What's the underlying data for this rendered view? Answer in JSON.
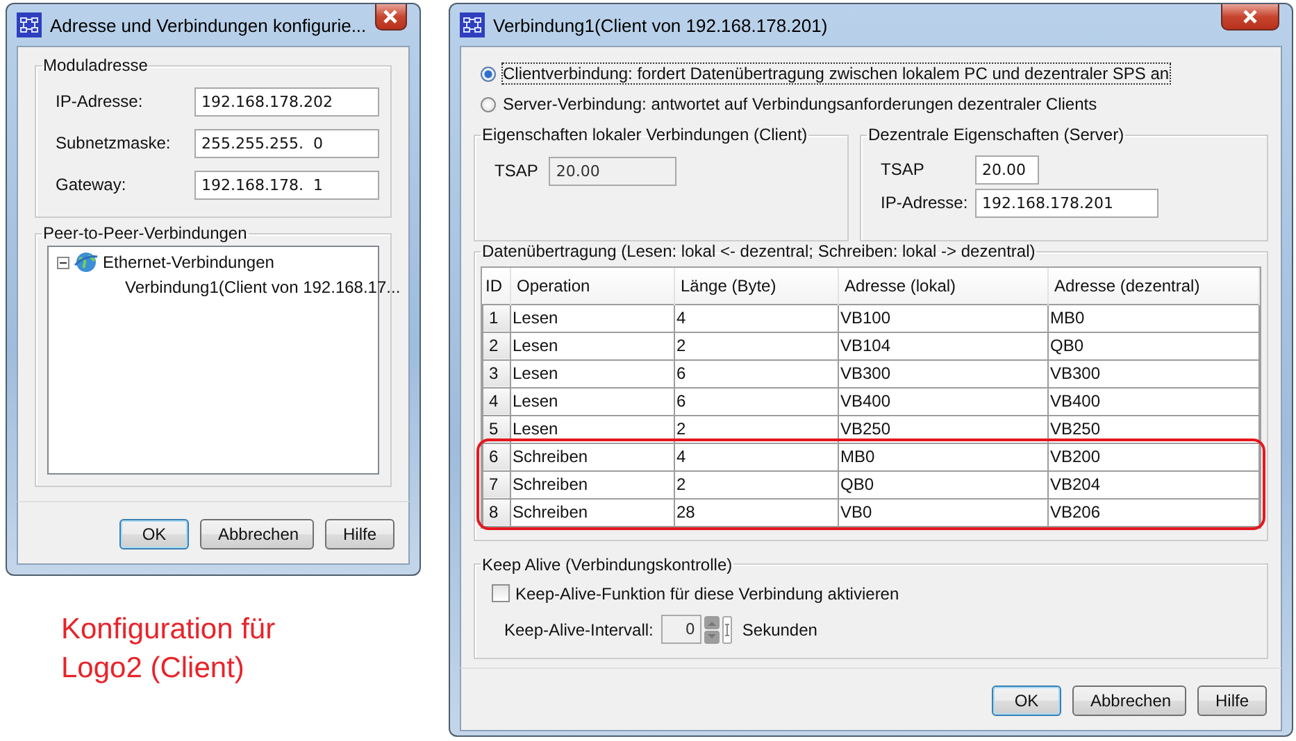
{
  "address_dialog": {
    "title": "Adresse und Verbindungen konfigurie...",
    "module_address": {
      "legend": "Moduladresse",
      "fields": [
        {
          "label": "IP-Adresse:",
          "value": "192.168.178.202"
        },
        {
          "label": "Subnetzmaske:",
          "value": "255.255.255.  0"
        },
        {
          "label": "Gateway:",
          "value": "192.168.178.  1"
        }
      ]
    },
    "peer_connections": {
      "legend": "Peer-to-Peer-Verbindungen",
      "tree": [
        {
          "label": "Ethernet-Verbindungen",
          "expanded": true,
          "children": [
            {
              "label": "Verbindung1(Client von  192.168.17..."
            }
          ]
        }
      ]
    },
    "buttons": [
      {
        "label": "OK",
        "default": true
      },
      {
        "label": "Abbrechen",
        "default": false
      },
      {
        "label": "Hilfe",
        "default": false
      }
    ]
  },
  "caption": "Konfiguration für Logo2 (Client)",
  "connection_dialog": {
    "title": "Verbindung1(Client von  192.168.178.201)",
    "connection_types": [
      {
        "label": "Clientverbindung: fordert Datenübertragung zwischen lokalem PC und dezentraler SPS an",
        "selected": true
      },
      {
        "label": "Server-Verbindung: antwortet auf Verbindungsanforderungen dezentraler Clients",
        "selected": false
      }
    ],
    "local_properties": {
      "legend": "Eigenschaften lokaler Verbindungen (Client)",
      "fields": [
        {
          "label": "TSAP",
          "value": "20.00",
          "disabled": true
        }
      ]
    },
    "remote_properties": {
      "legend": "Dezentrale Eigenschaften (Server)",
      "fields": [
        {
          "label": "TSAP",
          "value": "20.00",
          "disabled": false
        },
        {
          "label": "IP-Adresse:",
          "value": "192.168.178.201",
          "disabled": false
        }
      ]
    },
    "data_transfer": {
      "legend": "Datenübertragung (Lesen: lokal <- dezentral; Schreiben: lokal -> dezentral)",
      "columns": [
        "ID",
        "Operation",
        "Länge (Byte)",
        "Adresse (lokal)",
        "Adresse (dezentral)"
      ],
      "rows": [
        {
          "cells": [
            "1",
            "Lesen",
            "4",
            "VB100",
            "MB0"
          ],
          "highlighted": false
        },
        {
          "cells": [
            "2",
            "Lesen",
            "2",
            "VB104",
            "QB0"
          ],
          "highlighted": false
        },
        {
          "cells": [
            "3",
            "Lesen",
            "6",
            "VB300",
            "VB300"
          ],
          "highlighted": false
        },
        {
          "cells": [
            "4",
            "Lesen",
            "6",
            "VB400",
            "VB400"
          ],
          "highlighted": false
        },
        {
          "cells": [
            "5",
            "Lesen",
            "2",
            "VB250",
            "VB250"
          ],
          "highlighted": false
        },
        {
          "cells": [
            "6",
            "Schreiben",
            "4",
            "MB0",
            "VB200"
          ],
          "highlighted": true
        },
        {
          "cells": [
            "7",
            "Schreiben",
            "2",
            "QB0",
            "VB204"
          ],
          "highlighted": true
        },
        {
          "cells": [
            "8",
            "Schreiben",
            "28",
            "VB0",
            "VB206"
          ],
          "highlighted": true
        }
      ]
    },
    "keep_alive": {
      "legend": "Keep Alive (Verbindungskontrolle)",
      "checkbox": {
        "label": "Keep-Alive-Funktion für diese Verbindung aktivieren",
        "checked": false
      },
      "interval": {
        "label": "Keep-Alive-Intervall:",
        "value": "0",
        "unit": "Sekunden",
        "disabled": true
      }
    },
    "buttons": [
      {
        "label": "OK",
        "default": true
      },
      {
        "label": "Abbrechen",
        "default": false
      },
      {
        "label": "Hilfe",
        "default": false
      }
    ]
  }
}
